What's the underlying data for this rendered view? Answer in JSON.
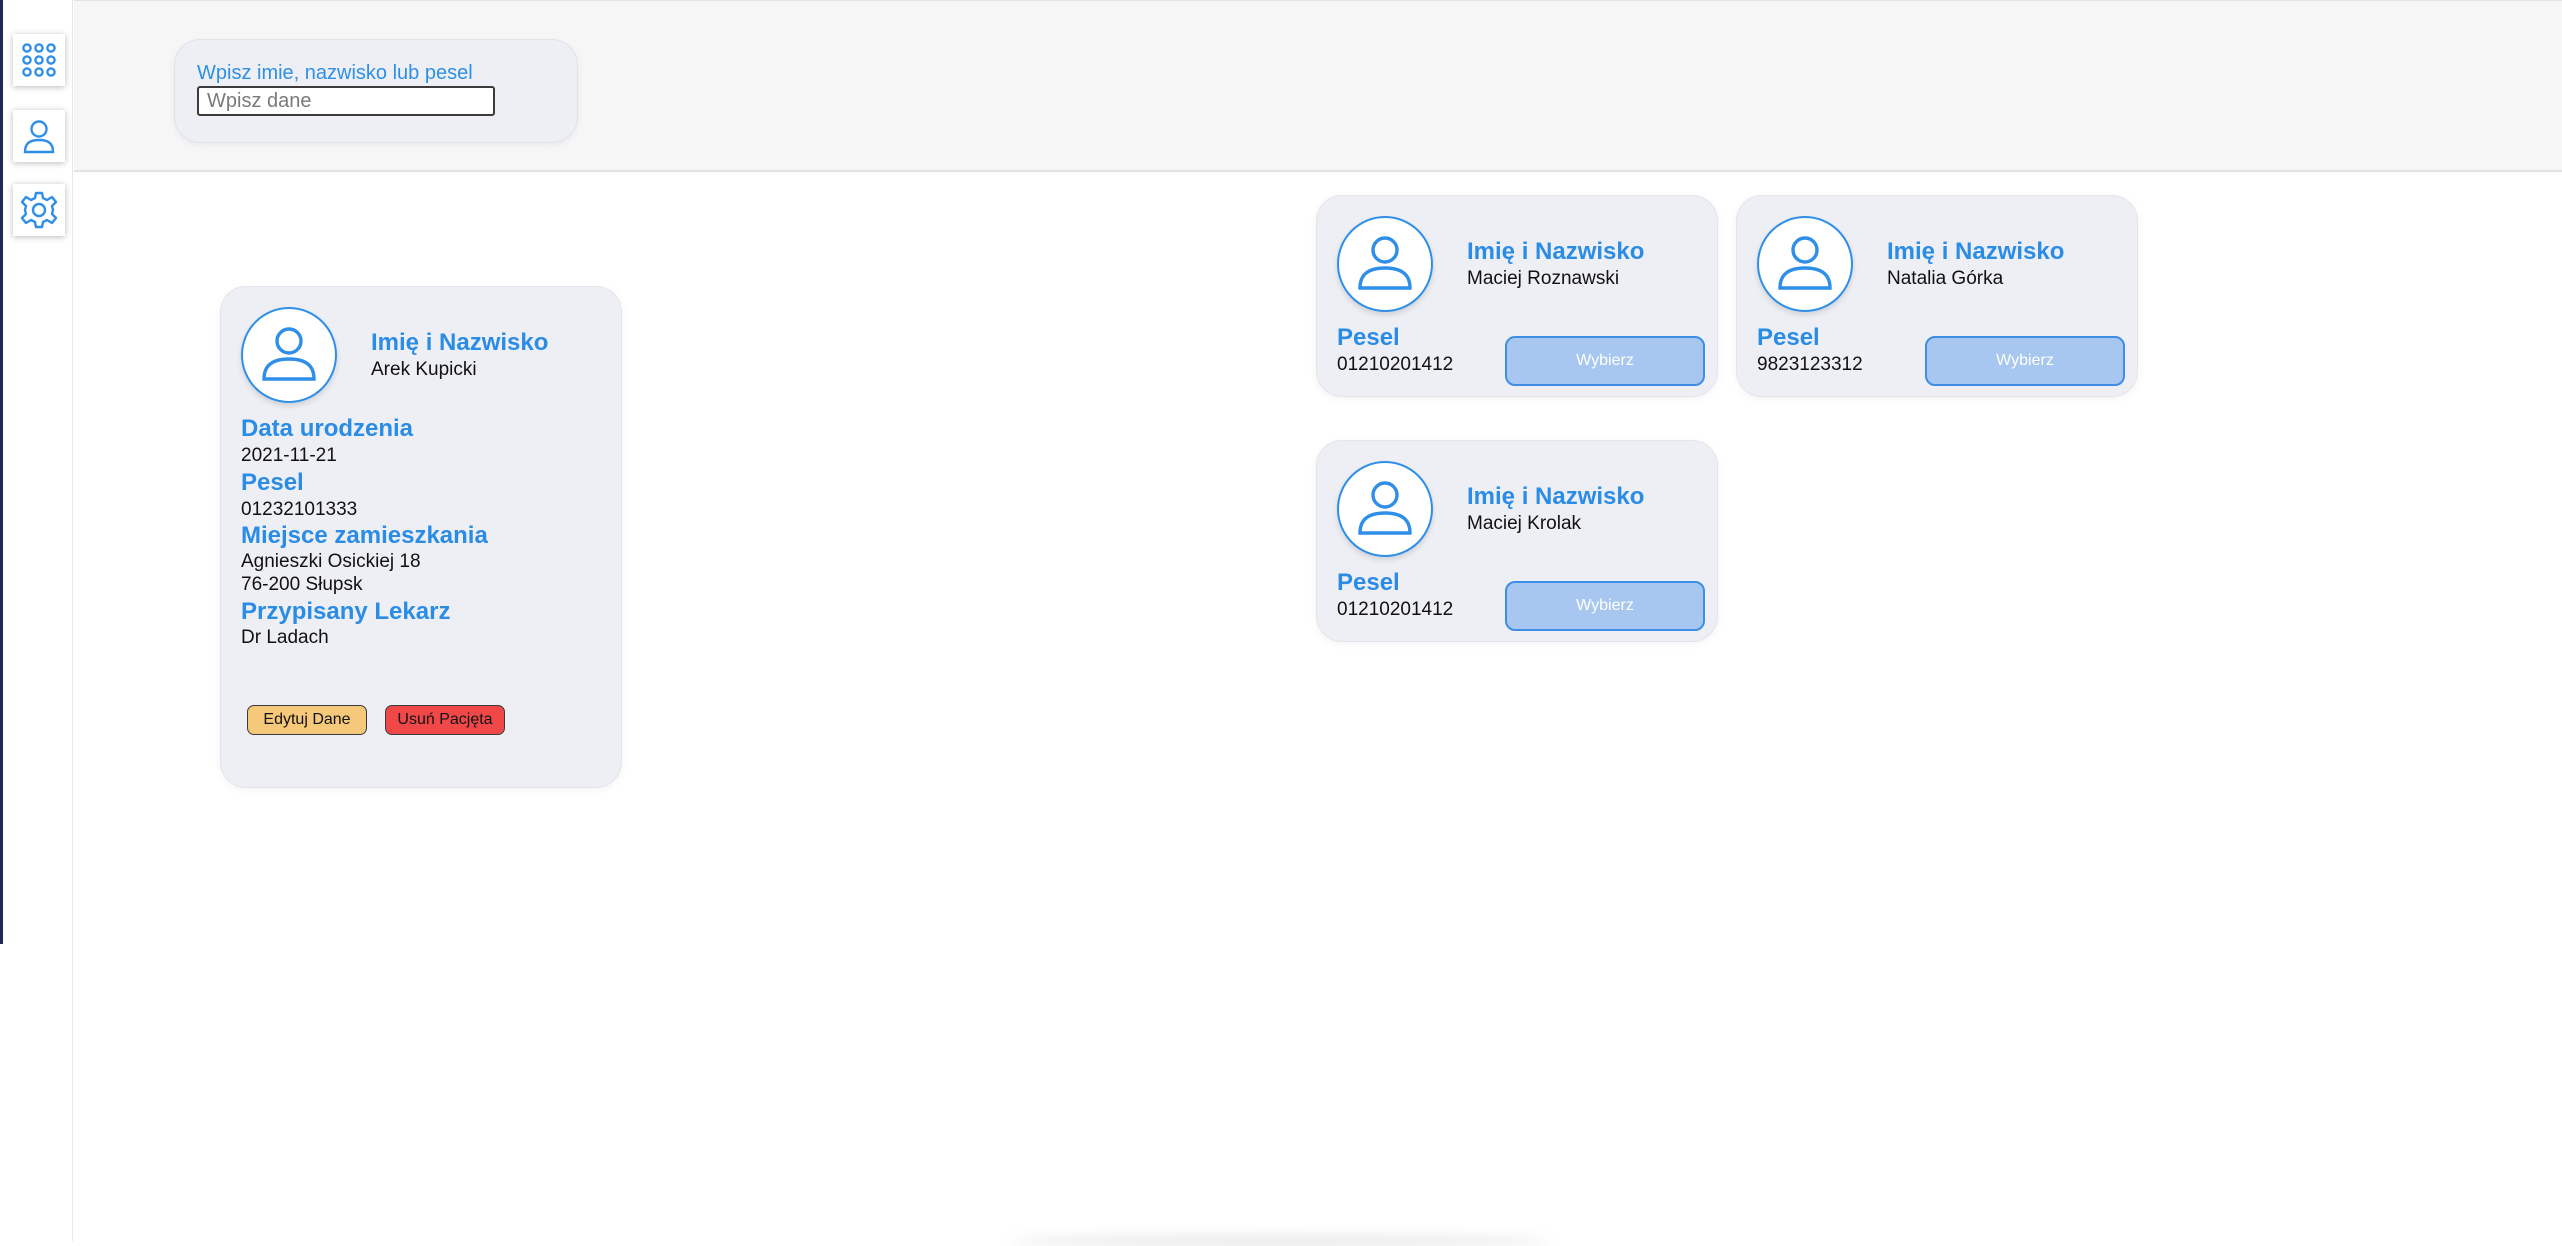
{
  "sidebar": {
    "items": [
      {
        "icon": "apps-grid-icon"
      },
      {
        "icon": "user-icon"
      },
      {
        "icon": "gear-icon"
      }
    ]
  },
  "search": {
    "label": "Wpisz imie, nazwisko lub pesel",
    "placeholder": "Wpisz dane",
    "value": ""
  },
  "patient_details": {
    "name_label": "Imię i Nazwisko",
    "name": "Arek Kupicki",
    "birth_label": "Data urodzenia",
    "birth_date": "2021-11-21",
    "pesel_label": "Pesel",
    "pesel": "01232101333",
    "address_label": "Miejsce zamieszkania",
    "address_line1": "Agnieszki Osickiej 18",
    "address_line2": "76-200 Słupsk",
    "doctor_label": "Przypisany Lekarz",
    "doctor": "Dr Ladach",
    "edit_button": "Edytuj Dane",
    "delete_button": "Usuń Pacjęta"
  },
  "results": [
    {
      "name_label": "Imię i Nazwisko",
      "name": "Maciej Roznawski",
      "pesel_label": "Pesel",
      "pesel": "01210201412",
      "select_label": "Wybierz"
    },
    {
      "name_label": "Imię i Nazwisko",
      "name": "Natalia Górka",
      "pesel_label": "Pesel",
      "pesel": "9823123312",
      "select_label": "Wybierz"
    },
    {
      "name_label": "Imię i Nazwisko",
      "name": "Maciej Krolak",
      "pesel_label": "Pesel",
      "pesel": "01210201412",
      "select_label": "Wybierz"
    }
  ],
  "colors": {
    "accent": "#2b8ce6",
    "edit": "#f6c97a",
    "delete": "#f04848",
    "select": "#a8c7f0",
    "card": "#eeeff4"
  }
}
